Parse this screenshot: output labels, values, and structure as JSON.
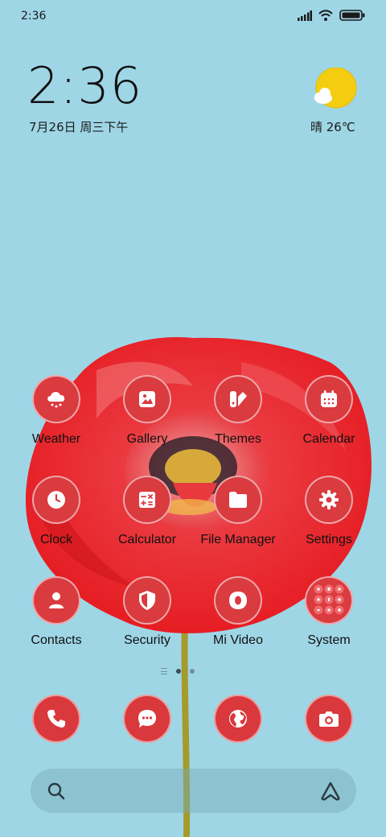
{
  "status_bar": {
    "time": "2:36",
    "icons": [
      "signal-icon",
      "wifi-icon",
      "battery-icon"
    ]
  },
  "clock_widget": {
    "time": "2:36",
    "date": "7月26日 周三下午"
  },
  "weather_widget": {
    "icon": "partly-sunny-icon",
    "text": "晴 26℃"
  },
  "apps": [
    {
      "label": "Weather",
      "icon": "weather-cloud-icon"
    },
    {
      "label": "Gallery",
      "icon": "gallery-icon"
    },
    {
      "label": "Themes",
      "icon": "themes-icon"
    },
    {
      "label": "Calendar",
      "icon": "calendar-icon"
    },
    {
      "label": "Clock",
      "icon": "clock-icon"
    },
    {
      "label": "Calculator",
      "icon": "calculator-icon"
    },
    {
      "label": "File Manager",
      "icon": "folder-icon"
    },
    {
      "label": "Settings",
      "icon": "gear-icon"
    },
    {
      "label": "Contacts",
      "icon": "person-icon"
    },
    {
      "label": "Security",
      "icon": "shield-icon"
    },
    {
      "label": "Mi Video",
      "icon": "video-icon"
    },
    {
      "label": "System",
      "icon": "folder-grid-icon"
    }
  ],
  "page_indicator": {
    "pages": 2,
    "current": 1
  },
  "dock": [
    {
      "name": "phone",
      "icon": "phone-icon"
    },
    {
      "name": "messages",
      "icon": "message-icon"
    },
    {
      "name": "browser",
      "icon": "globe-icon"
    },
    {
      "name": "camera",
      "icon": "camera-icon"
    }
  ],
  "search_bar": {
    "left_icon": "search-icon",
    "right_icon": "assistant-icon"
  },
  "colors": {
    "background": "#9fd6e6",
    "icon_red": "#d93b3f",
    "flower_red": "#e8242a"
  }
}
